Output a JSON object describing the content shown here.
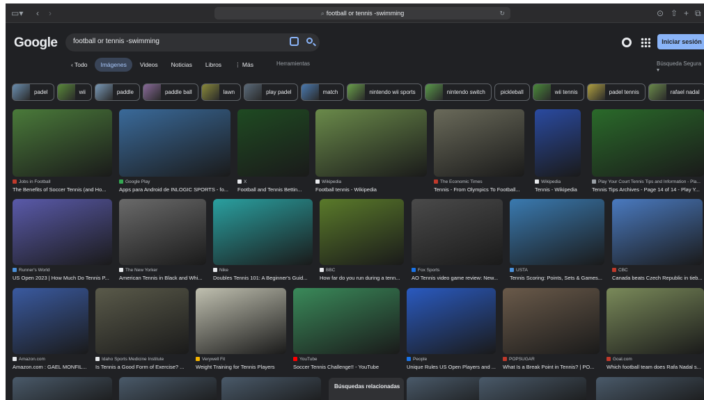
{
  "browser": {
    "url": "football or tennis -swimming"
  },
  "header": {
    "logo": "Google",
    "query": "football or tennis -swimming",
    "signin": "Iniciar sesión"
  },
  "tabs": [
    {
      "label": "‹ Todo"
    },
    {
      "label": "Imágenes"
    },
    {
      "label": "Videos"
    },
    {
      "label": "Noticias"
    },
    {
      "label": "Libros"
    },
    {
      "label": "⋮ Más"
    }
  ],
  "tools_label": "Herramientas",
  "safesearch_label": "Búsqueda Segura ▾",
  "chips": [
    {
      "label": "padel",
      "color": "#6a8fb0"
    },
    {
      "label": "wii",
      "color": "#5a8a3a"
    },
    {
      "label": "paddle",
      "color": "#7a9ab8"
    },
    {
      "label": "paddle ball",
      "color": "#8a6a9a"
    },
    {
      "label": "lawn",
      "color": "#8a8a3a"
    },
    {
      "label": "play padel",
      "color": "#5a6a7a"
    },
    {
      "label": "match",
      "color": "#4a7ab0"
    },
    {
      "label": "nintendo wii sports",
      "color": "#6aa04a"
    },
    {
      "label": "nintendo switch",
      "color": "#5a9a4a"
    },
    {
      "label": "pickleball",
      "color": ""
    },
    {
      "label": "wii tennis",
      "color": "#4a8a3a"
    },
    {
      "label": "padel tennis",
      "color": "#b0a040"
    },
    {
      "label": "rafael nadal",
      "color": "#6a8a4a"
    }
  ],
  "results_row1": [
    {
      "source": "Jobs in Football",
      "title": "The Benefits of Soccer Tennis (and Ho...",
      "fav": "#c0392b"
    },
    {
      "source": "Google Play",
      "title": "Apps para Android de INLOGIC SPORTS - fo...",
      "fav": "#34a853"
    },
    {
      "source": "X",
      "title": "Football and Tennis Bettin...",
      "fav": "#e8eaed"
    },
    {
      "source": "Wikipedia",
      "title": "Football tennis - Wikipedia",
      "fav": "#e8eaed"
    },
    {
      "source": "The Economic Times",
      "title": "Tennis - From Olympics To Football...",
      "fav": "#c0392b"
    },
    {
      "source": "Wikipedia",
      "title": "Tennis - Wikipedia",
      "fav": "#e8eaed"
    },
    {
      "source": "Play Your Court Tennis Tips and Information - Pla...",
      "title": "Tennis Tips Archives - Page 14 of 14 - Play Y...",
      "fav": "#9aa0a6"
    }
  ],
  "results_row2": [
    {
      "source": "Runner's World",
      "title": "US Open 2023 | How Much Do Tennis P...",
      "fav": "#4a90d9"
    },
    {
      "source": "The New Yorker",
      "title": "American Tennis in Black and Whi...",
      "fav": "#e8eaed"
    },
    {
      "source": "Nike",
      "title": "Doubles Tennis 101: A Beginner's Guid...",
      "fav": "#e8eaed"
    },
    {
      "source": "BBC",
      "title": "How far do you run during a tenn...",
      "fav": "#e8eaed"
    },
    {
      "source": "Fox Sports",
      "title": "AO Tennis video game review: New...",
      "fav": "#1a73e8"
    },
    {
      "source": "USTA",
      "title": "Tennis Scoring: Points, Sets & Games...",
      "fav": "#4a90d9"
    },
    {
      "source": "CBC",
      "title": "Canada beats Czech Republic in tieb...",
      "fav": "#c0392b"
    }
  ],
  "results_row3": [
    {
      "source": "Amazon.com",
      "title": "Amazon.com : GAEL MONFIL...",
      "fav": "#e8eaed"
    },
    {
      "source": "Idaho Sports Medicine Institute",
      "title": "Is Tennis a Good Form of Exercise? ...",
      "fav": "#e8eaed"
    },
    {
      "source": "Verywell Fit",
      "title": "Weight Training for Tennis Players",
      "fav": "#f5b400"
    },
    {
      "source": "YouTube",
      "title": "Soccer Tennis Challenge!! - YouTube",
      "fav": "#ff0000"
    },
    {
      "source": "People",
      "title": "Unique Rules US Open Players and ...",
      "fav": "#1a73e8"
    },
    {
      "source": "POPSUGAR",
      "title": "What Is a Break Point in Tennis? | PO...",
      "fav": "#c0392b"
    },
    {
      "source": "Goal.com",
      "title": "Which football team does Rafa Nadal s...",
      "fav": "#c0392b"
    }
  ],
  "related_label": "Búsquedas relacionadas"
}
